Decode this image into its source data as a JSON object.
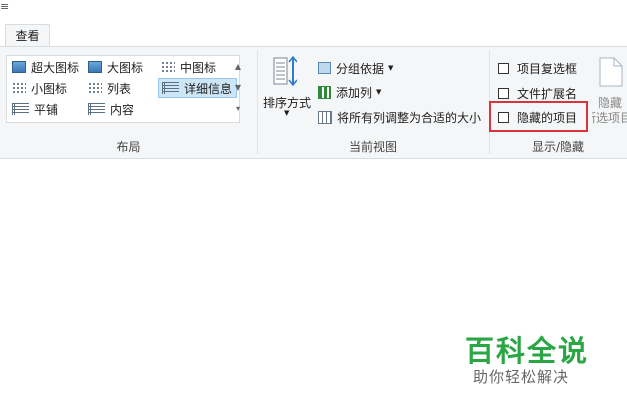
{
  "edge_glyph": "≡",
  "tabs": [
    {
      "label": "查看"
    }
  ],
  "layout_group": {
    "label": "布局",
    "items": [
      {
        "label": "超大图标",
        "icon": "extra-large-icons-icon"
      },
      {
        "label": "大图标",
        "icon": "large-icons-icon"
      },
      {
        "label": "中图标",
        "icon": "medium-icons-icon"
      },
      {
        "label": "小图标",
        "icon": "small-icons-icon"
      },
      {
        "label": "列表",
        "icon": "list-icon"
      },
      {
        "label": "详细信息",
        "icon": "details-icon",
        "selected": true
      },
      {
        "label": "平铺",
        "icon": "tiles-icon"
      },
      {
        "label": "内容",
        "icon": "content-icon"
      }
    ]
  },
  "current_view_group": {
    "label": "当前视图",
    "sort_label": "排序方式",
    "group_by_label": "分组依据",
    "add_column_label": "添加列",
    "fit_columns_label": "将所有列调整为合适的大小"
  },
  "show_hide_group": {
    "label": "显示/隐藏",
    "checkboxes": [
      {
        "label": "项目复选框",
        "checked": false
      },
      {
        "label": "文件扩展名",
        "checked": false
      },
      {
        "label": "隐藏的项目",
        "checked": false
      }
    ],
    "hide_button_line1": "隐藏",
    "hide_button_line2": "所选项目"
  },
  "watermark": {
    "title": "百科全说",
    "subtitle": "助你轻松解决"
  },
  "colors": {
    "highlight": "#d9343b",
    "watermark_green": "#2aa744",
    "selection": "#cde6f7"
  }
}
